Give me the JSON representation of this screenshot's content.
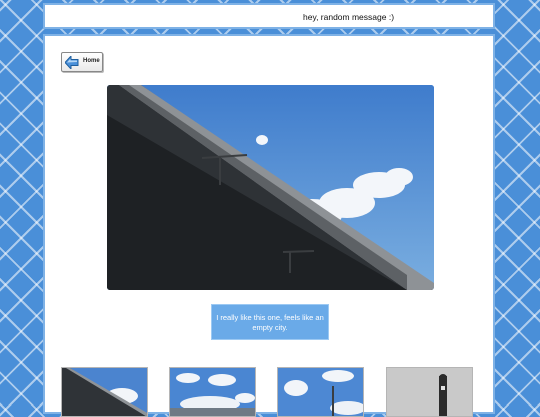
{
  "banner": {
    "message": "hey, random message :)"
  },
  "nav": {
    "home_label": "Home"
  },
  "main_photo": {
    "subject": "concrete overpass against blue sky with clouds"
  },
  "caption": {
    "text": "I really like this one, feels like an empty city."
  },
  "thumbnails": [
    {
      "subject": "overpass under blue sky"
    },
    {
      "subject": "clouds over rooftops"
    },
    {
      "subject": "street lamp and clouds"
    },
    {
      "subject": "tower silhouette"
    }
  ],
  "colors": {
    "page_background": "#4a8fd8",
    "panel_border": "#7fb2e6",
    "caption_background": "#6aaae8"
  }
}
